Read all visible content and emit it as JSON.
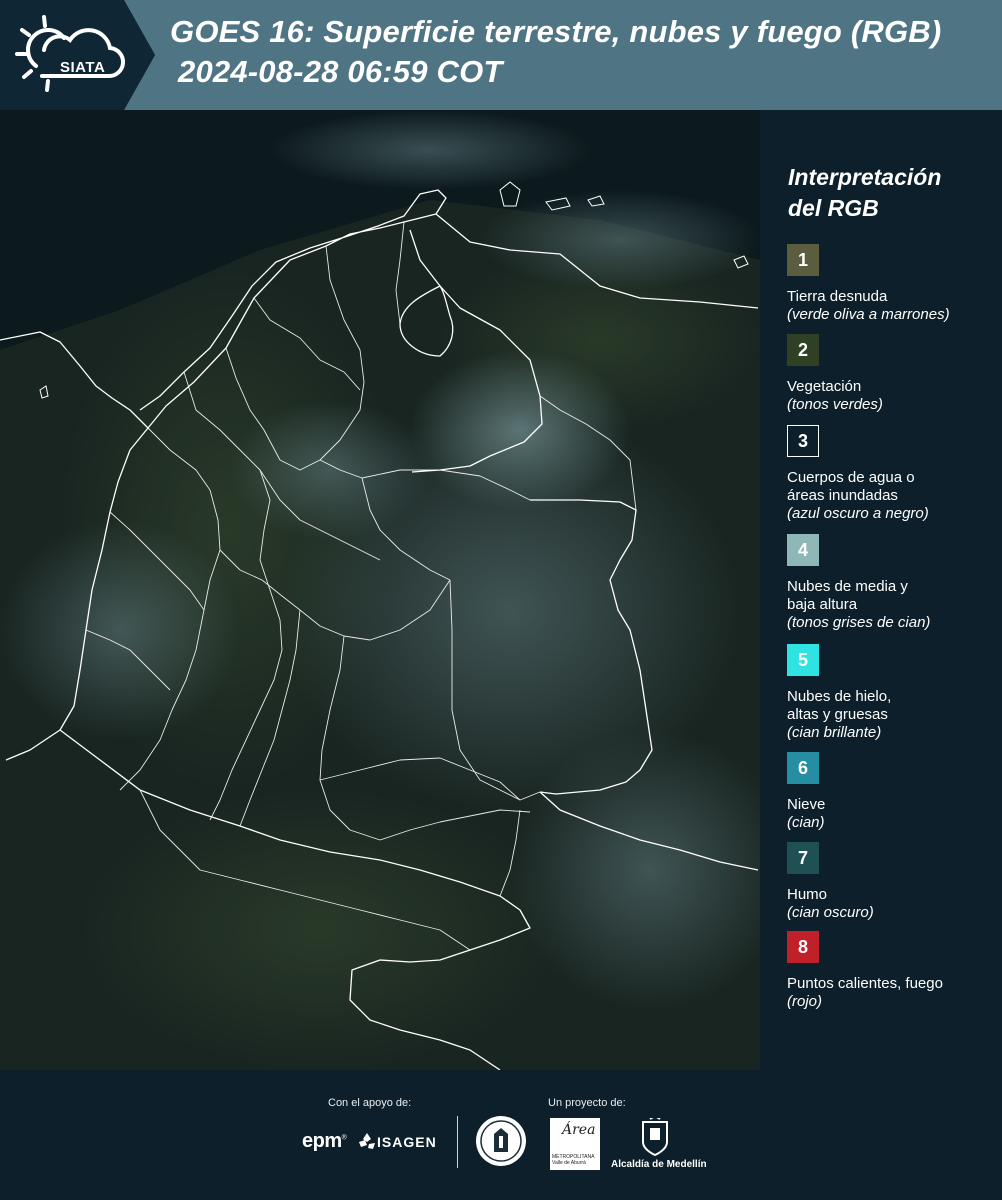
{
  "header": {
    "logo_text": "SIATA",
    "title_line1": "GOES 16: Superficie terrestre, nubes y fuego (RGB)",
    "title_line2": "2024-08-28 06:59 COT",
    "colors": {
      "left_bg": "#0f2634",
      "right_bg": "#4f7483"
    }
  },
  "map": {
    "icon": "satellite-map",
    "colors": {
      "background": "#0d1a1d",
      "border": "#ffffff"
    }
  },
  "legend": {
    "title_line1": "Interpretación",
    "title_line2": "del RGB",
    "items": [
      {
        "number": "1",
        "label": [
          "Tierra desnuda"
        ],
        "sub": "(verde oliva a marrones)",
        "color": "#5b5c40"
      },
      {
        "number": "2",
        "label": [
          "Vegetación"
        ],
        "sub": "(tonos verdes)",
        "color": "#2f4024"
      },
      {
        "number": "3",
        "label": [
          "Cuerpos de agua o",
          "áreas inundadas"
        ],
        "sub": "(azul oscuro a negro)",
        "color": "#0c1f2a"
      },
      {
        "number": "4",
        "label": [
          "Nubes de media y",
          "baja altura"
        ],
        "sub": "(tonos grises de cian)",
        "color": "#8fb7b8"
      },
      {
        "number": "5",
        "label": [
          "Nubes de hielo,",
          "altas y gruesas"
        ],
        "sub": "(cian brillante)",
        "color": "#2fe3e3"
      },
      {
        "number": "6",
        "label": [
          "Nieve"
        ],
        "sub": "(cian)",
        "color": "#258ea2"
      },
      {
        "number": "7",
        "label": [
          "Humo"
        ],
        "sub": "(cian oscuro)",
        "color": "#1f5054"
      },
      {
        "number": "8",
        "label": [
          "Puntos calientes, fuego"
        ],
        "sub": "(rojo)",
        "color": "#c0202a"
      }
    ]
  },
  "footer": {
    "support_label": "Con el apoyo de:",
    "project_label": "Un proyecto de:",
    "epm": "epm",
    "epm_mark": "®",
    "isagen": "ISAGEN",
    "area_script": "Área",
    "area_caption": [
      "METROPOLITANA",
      "Valle de Aburrá"
    ],
    "alcaldia": "Alcaldía de Medellín"
  }
}
